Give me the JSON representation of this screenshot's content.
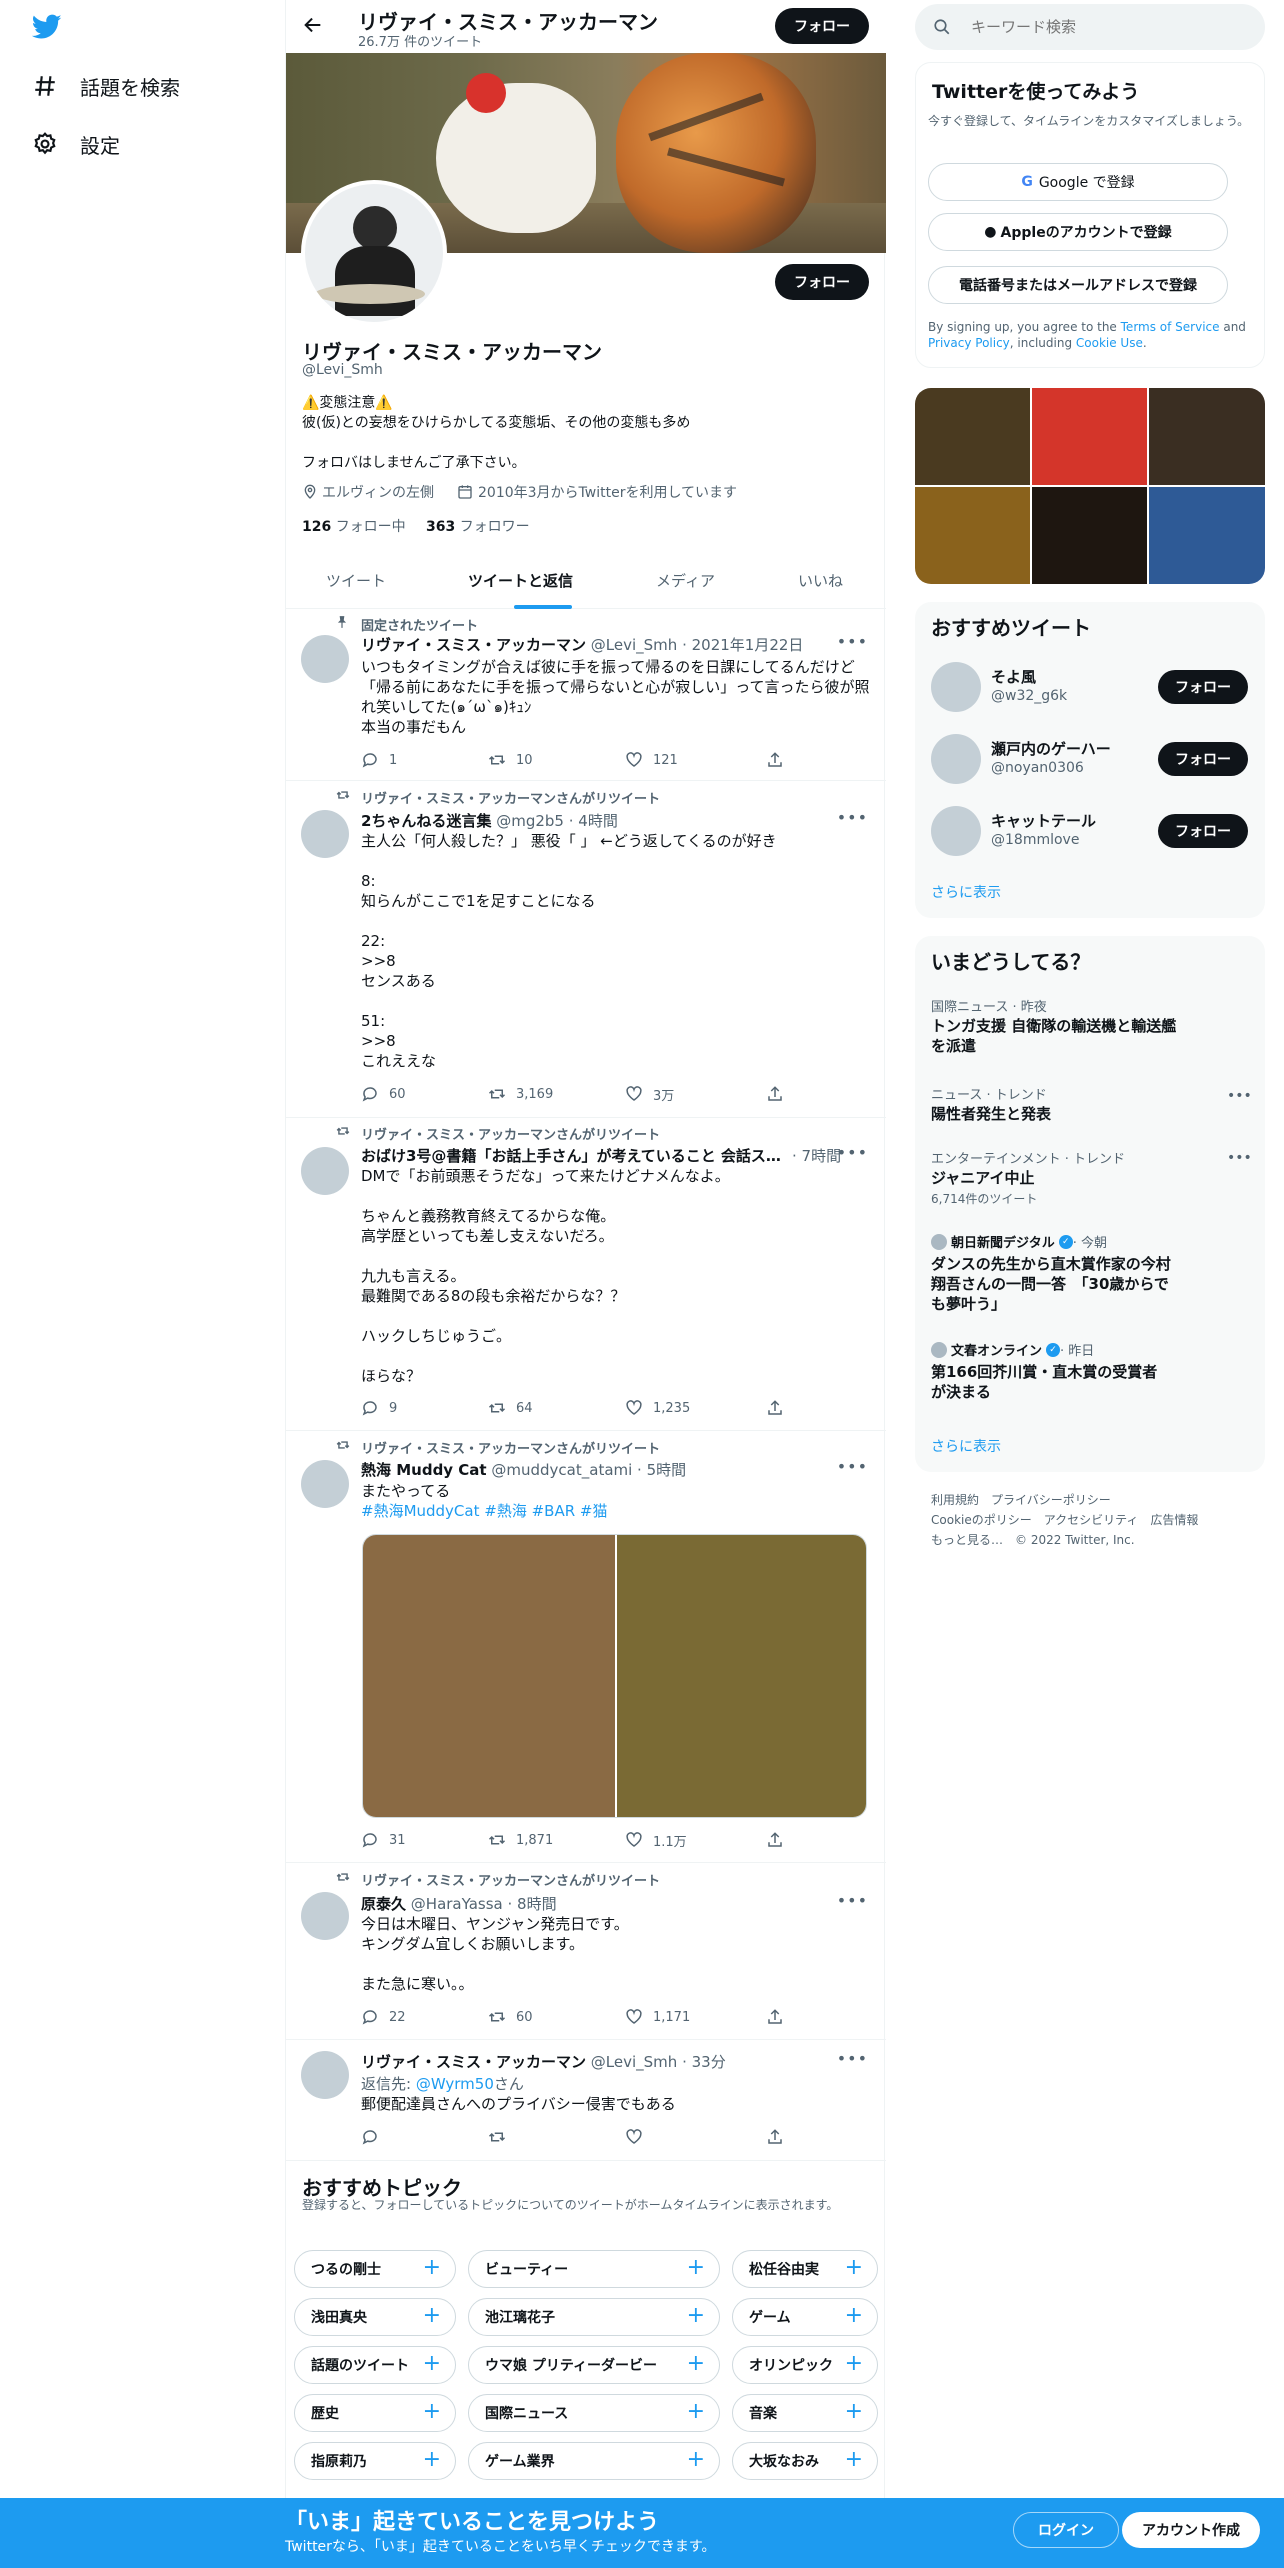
{
  "nav": {
    "explore_label": "話題を検索",
    "settings_label": "設定"
  },
  "header": {
    "name": "リヴァイ・スミス・アッカーマン",
    "tweet_count": "26.7万 件のツイート",
    "follow_label": "フォロー"
  },
  "profile": {
    "follow_label": "フォロー",
    "name": "リヴァイ・スミス・アッカーマン",
    "handle": "@Levi_Smh",
    "bio": "⚠️変態注意⚠️\n彼(仮)との妄想をひけらかしてる変態垢、その他の変態も多め\n\nフォロバはしませんご了承下さい。",
    "location": "エルヴィンの左側",
    "joined": "2010年3月からTwitterを利用しています",
    "following_count": "126",
    "following_label": "フォロー中",
    "followers_count": "363",
    "followers_label": "フォロワー"
  },
  "tabs": [
    "ツイート",
    "ツイートと返信",
    "メディア",
    "いいね"
  ],
  "tweets": [
    {
      "context": "固定されたツイート",
      "name": "リヴァイ・スミス・アッカーマン",
      "meta": "@Levi_Smh · 2021年1月22日",
      "text": "いつもタイミングが合えば彼に手を振って帰るのを日課にしてるんだけど「帰る前にあなたに手を振って帰らないと心が寂しい」って言ったら彼が照れ笑いしてた(๑´ω`๑)ｷｭﾝ\n本当の事だもん",
      "replies": "1",
      "retweets": "10",
      "likes": "121"
    },
    {
      "context": "リヴァイ・スミス・アッカーマンさんがリツイート",
      "name": "2ちゃんねる迷言集",
      "meta": "@mg2b5 · 4時間",
      "text": "主人公「何人殺した？」 悪役「 」 ←どう返してくるのが好き\n\n8:\n知らんがここで1を足すことになる\n\n22:\n>>8\nセンスある\n\n51:\n>>8\nこれええな",
      "replies": "60",
      "retweets": "3,169",
      "likes": "3万"
    },
    {
      "context": "リヴァイ・スミス・アッカーマンさんがリツイート",
      "name": "おばけ3号@書籍「お話上手さん」が考えていること 会話ス…",
      "meta": "· 7時間",
      "text": "DMで「お前頭悪そうだな」って来たけどナメんなよ。\n\nちゃんと義務教育終えてるからな俺。\n高学歴といっても差し支えないだろ。\n\n九九も言える。\n最難関である8の段も余裕だからな？？\n\nハックしちじゅうご。\n\nほらな？",
      "replies": "9",
      "retweets": "64",
      "likes": "1,235"
    },
    {
      "context": "リヴァイ・スミス・アッカーマンさんがリツイート",
      "name": "熱海 Muddy Cat",
      "meta": "@muddycat_atami · 5時間",
      "text": "またやってる",
      "hashtags": "#熱海MuddyCat #熱海 #BAR #猫",
      "replies": "31",
      "retweets": "1,871",
      "likes": "1.1万"
    },
    {
      "context": "リヴァイ・スミス・アッカーマンさんがリツイート",
      "name": "原泰久",
      "meta": "@HaraYassa · 8時間",
      "text": "今日は木曜日、ヤンジャン発売日です。\nキングダム宜しくお願いします。\n\nまた急に寒い。。",
      "replies": "22",
      "retweets": "60",
      "likes": "1,171"
    },
    {
      "name": "リヴァイ・スミス・アッカーマン",
      "meta": "@Levi_Smh · 33分",
      "reply_prefix": "返信先: ",
      "reply_to": "@Wyrm50",
      "reply_suffix": "さん",
      "text": "郵便配達員さんへのプライバシー侵害でもある"
    }
  ],
  "topics": {
    "title": "おすすめトピック",
    "subtitle": "登録すると、フォローしているトピックについてのツイートがホームタイムラインに表示されます。",
    "items": [
      "つるの剛士",
      "ビューティー",
      "松任谷由実",
      "浅田真央",
      "池江璃花子",
      "ゲーム",
      "話題のツイート",
      "ウマ娘 プリティーダービー",
      "オリンピック",
      "歴史",
      "国際ニュース",
      "音楽",
      "指原莉乃",
      "ゲーム業界",
      "大坂なおみ"
    ]
  },
  "search": {
    "placeholder": "キーワード検索"
  },
  "signup": {
    "title": "Twitterを使ってみよう",
    "subtitle": "今すぐ登録して、タイムラインをカスタマイズしましょう。",
    "google": "Google で登録",
    "apple": "Appleのアカウントで登録",
    "phone": "電話番号またはメールアドレスで登録",
    "legal_1": "By signing up, you agree to the ",
    "terms": "Terms of Service",
    "legal_2": " and ",
    "privacy": "Privacy Policy",
    "legal_3": ", including ",
    "cookie": "Cookie Use",
    "legal_4": "."
  },
  "recommended": {
    "title": "おすすめツイート",
    "users": [
      {
        "name": "そよ風",
        "handle": "@w32_g6k"
      },
      {
        "name": "瀬戸内のゲーハー",
        "handle": "@noyan0306"
      },
      {
        "name": "キャットテール",
        "handle": "@18mmlove"
      }
    ],
    "follow_label": "フォロー",
    "more": "さらに表示"
  },
  "trends": {
    "title": "いまどうしてる？",
    "items": [
      {
        "meta": "国際ニュース · 昨夜",
        "title": "トンガ支援 自衛隊の輸送機と輸送艦を派遣"
      },
      {
        "meta": "ニュース · トレンド",
        "title": "陽性者発生と発表"
      },
      {
        "meta": "エンターテインメント · トレンド",
        "title": "ジャニアイ中止",
        "sub": "6,714件のツイート"
      },
      {
        "source": "朝日新聞デジタル",
        "time": " · 今朝",
        "title": "ダンスの先生から直木賞作家の今村翔吾さんの一問一答　「30歳からでも夢叶う」"
      },
      {
        "source": "文春オンライン",
        "time": " · 昨日",
        "title": "第166回芥川賞・直木賞の受賞者が決まる"
      }
    ],
    "more": "さらに表示"
  },
  "footer": {
    "line1": "利用規約　プライバシーポリシー",
    "line2": "Cookieのポリシー　アクセシビリティ　広告情報",
    "line3": "もっと見る…　© 2022 Twitter, Inc."
  },
  "banner": {
    "title": "「いま」起きていることを見つけよう",
    "subtitle": "Twitterなら、「いま」起きていることをいち早くチェックできます。",
    "login": "ログイン",
    "signup": "アカウント作成"
  },
  "colors": {
    "accent": "#1d9bf0",
    "banner": "#1d9bf0",
    "text": "#0f1419",
    "muted": "#536471"
  }
}
